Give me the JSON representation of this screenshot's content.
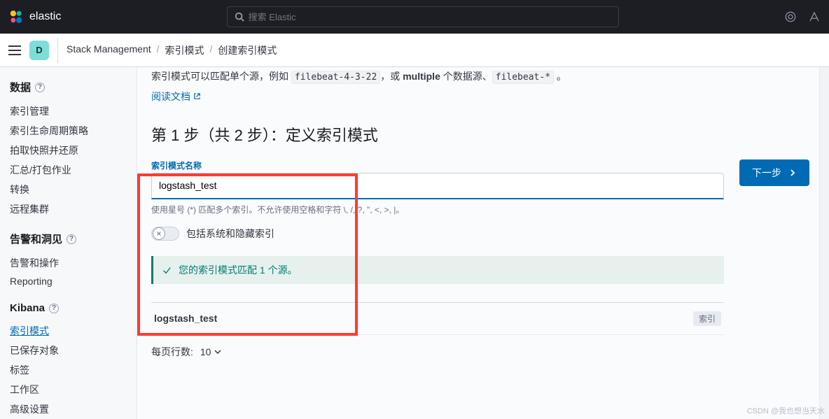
{
  "header": {
    "brand": "elastic",
    "search_placeholder": "搜索 Elastic"
  },
  "subheader": {
    "space_initial": "D",
    "breadcrumbs": {
      "item1": "Stack Management",
      "item2": "索引模式",
      "item3": "创建索引模式"
    }
  },
  "sidebar": {
    "data": {
      "title": "数据",
      "items": [
        "索引管理",
        "索引生命周期策略",
        "拍取快照并还原",
        "汇总/打包作业",
        "转换",
        "远程集群"
      ]
    },
    "alerts": {
      "title": "告警和洞见",
      "items": [
        "告警和操作",
        "Reporting"
      ]
    },
    "kibana": {
      "title": "Kibana",
      "items": [
        "索引模式",
        "已保存对象",
        "标签",
        "工作区",
        "高级设置"
      ],
      "active_index": 0
    }
  },
  "main": {
    "intro_prefix": "索引模式可以匹配单个源，例如 ",
    "intro_code1": "filebeat-4-3-22",
    "intro_mid": "，或 ",
    "intro_strong": "multiple",
    "intro_mid2": " 个数据源、",
    "intro_code2": "filebeat-*",
    "intro_suffix": " 。",
    "doc_link": "阅读文档",
    "step_title": "第 1 步（共 2 步）：定义索引模式",
    "form": {
      "label": "索引模式名称",
      "value": "logstash_test",
      "help": "使用星号 (*) 匹配多个索引。不允许使用空格和字符 \\, /, ?, \", <, >, |。"
    },
    "next_button": "下一步",
    "toggle_label": "包括系统和隐藏索引",
    "callout": "您的索引模式匹配 1 个源。",
    "results": [
      {
        "name": "logstash_test",
        "type": "索引"
      }
    ],
    "pager_label": "每页行数:",
    "pager_size": "10"
  },
  "watermark": "CSDN @我也想当天水"
}
